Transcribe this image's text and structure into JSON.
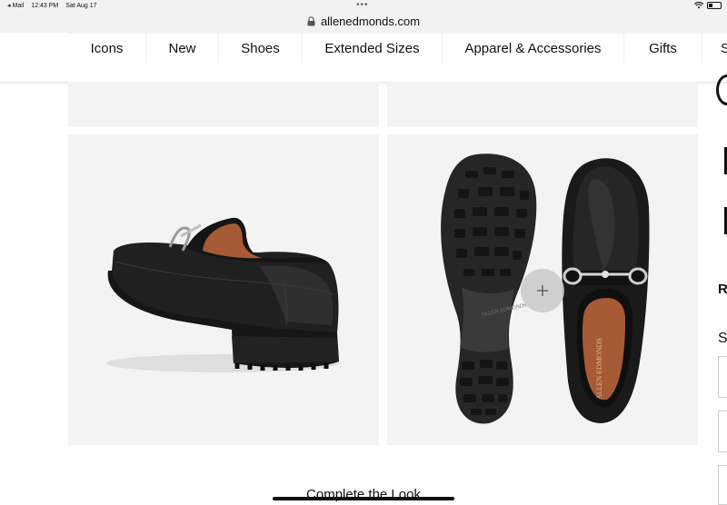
{
  "status_bar": {
    "back_app": "◂ Mail",
    "time": "12:43 PM",
    "date": "Sat Aug 17",
    "dots": "•••"
  },
  "url_bar": {
    "domain": "allenedmonds.com",
    "lock_icon": "lock-icon"
  },
  "nav": {
    "items": [
      {
        "label": "Icons"
      },
      {
        "label": "New"
      },
      {
        "label": "Shoes"
      },
      {
        "label": "Extended Sizes"
      },
      {
        "label": "Apparel & Accessories"
      },
      {
        "label": "Gifts"
      },
      {
        "label": "S"
      }
    ]
  },
  "gallery": {
    "zoom_icon": "plus-icon",
    "sole_brand_text": "ALLEN EDMONDS",
    "insole_brand_text": "ALLEN EDMONDS"
  },
  "right_edge": {
    "letter_r": "R",
    "letter_s": "S"
  },
  "section": {
    "complete_the_look": "Complete the Look"
  },
  "colors": {
    "tile_bg": "#f3f3f3",
    "leather": "#1b1b1b",
    "lining": "#a65a36",
    "hardware": "#c8c8c8"
  }
}
